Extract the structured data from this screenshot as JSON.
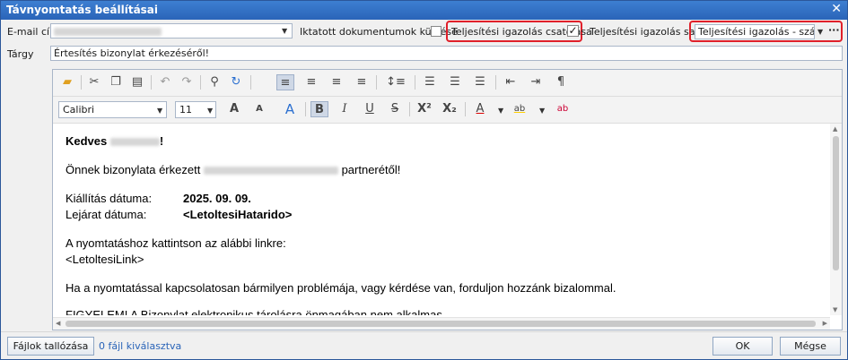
{
  "window": {
    "title": "Távnyomtatás beállításai",
    "close": "✕"
  },
  "form": {
    "email_label": "E-mail cím",
    "iktatott_label": "Iktatott dokumentumok küldése",
    "teljesitesi_csatolas_label": "Teljesítési igazolás csatolása",
    "teljesitesi_csatolas_checked": "✓",
    "sablon_label": "Teljesítési igazolás sablon",
    "sablon_value": "Teljesítési igazolás - számla",
    "sablon_more": "···",
    "targy_label": "Tárgy",
    "targy_value": "Értesítés bizonylat érkezéséről!"
  },
  "toolbar": {
    "font_name": "Calibri",
    "font_size": "11",
    "bold": "B",
    "italic": "I",
    "underline": "U",
    "strike": "S",
    "superscript": "X²",
    "subscript": "X₂",
    "font_color": "A",
    "highlight": "ab",
    "clear_format": "ab",
    "grow_font": "A",
    "shrink_font": "A",
    "change_case": "A"
  },
  "message": {
    "greeting_prefix": "Kedves",
    "greeting_suffix": "!",
    "line1_prefix": "Önnek bizonylata érkezett",
    "line1_suffix": "partnerétől!",
    "kiallitas_label": "Kiállítás dátuma:",
    "kiallitas_value": "2025. 09. 09.",
    "lejarat_label": "Lejárat dátuma:",
    "lejarat_value": "<LetoltesiHatarido>",
    "link_intro": "A nyomtatáshoz kattintson az alábbi linkre:",
    "link_value": "<LetoltesiLink>",
    "help_text": "Ha a nyomtatással kapcsolatosan bármilyen problémája, vagy kérdése van, forduljon hozzánk bizalommal.",
    "warning_partial": "FIGYELEM! A Bizonylat elektronikus tárolásra önmagában nem alkalmas."
  },
  "footer": {
    "browse_label": "Fájlok tallózása",
    "files_selected": "0 fájl kiválasztva",
    "ok_label": "OK",
    "cancel_label": "Mégse"
  }
}
